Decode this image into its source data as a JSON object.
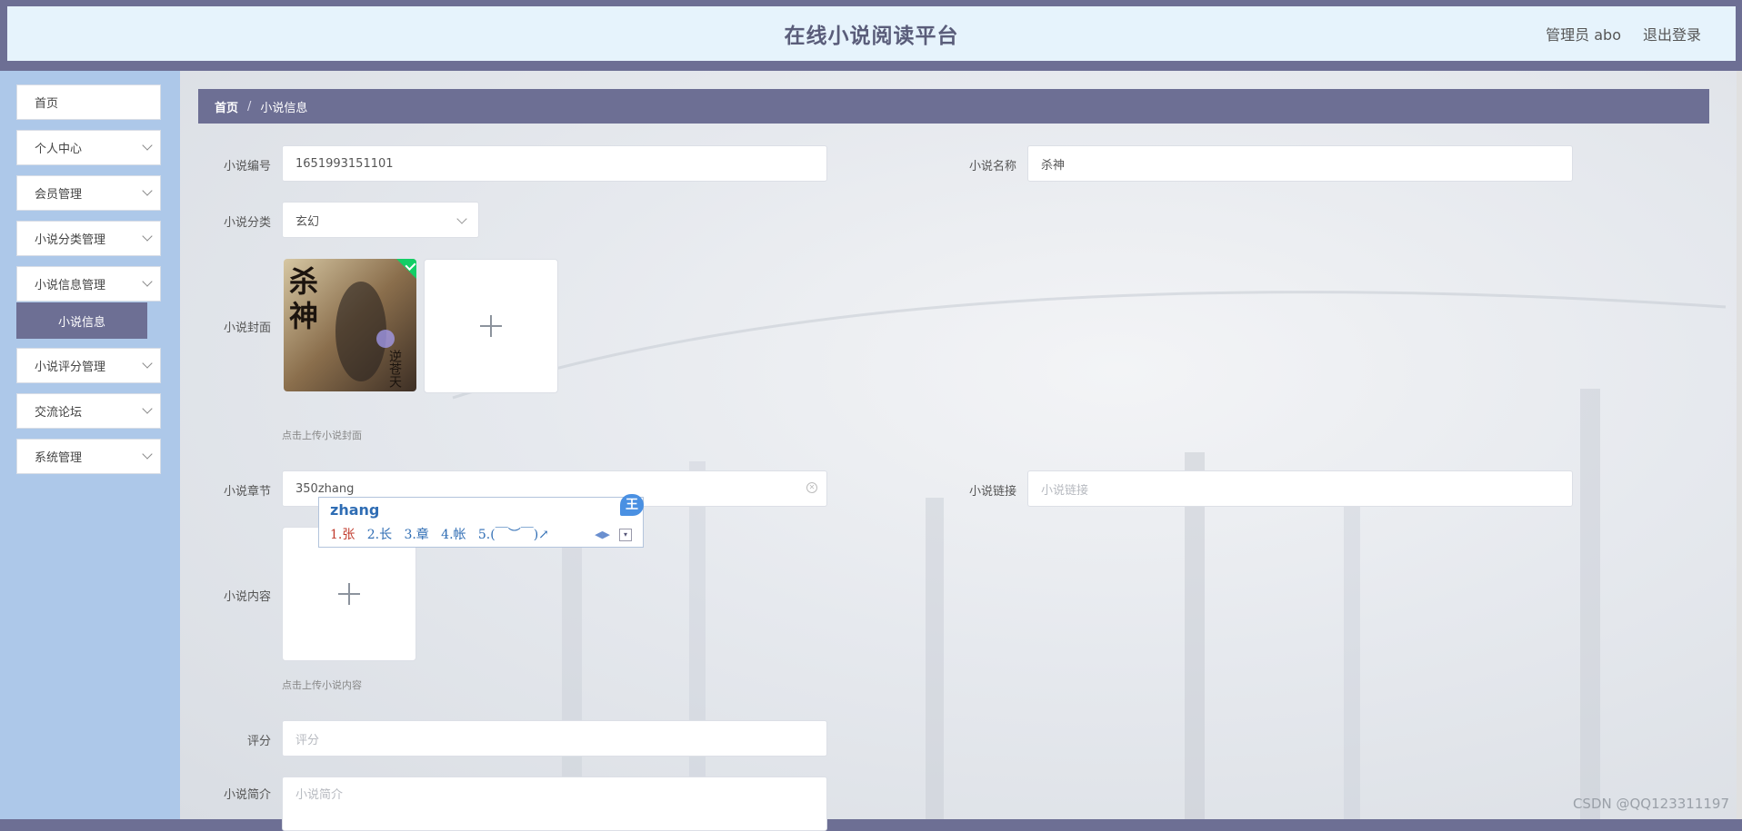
{
  "header": {
    "title": "在线小说阅读平台",
    "user": "管理员 abo",
    "logout": "退出登录"
  },
  "sidebar": {
    "items": [
      {
        "label": "首页"
      },
      {
        "label": "个人中心"
      },
      {
        "label": "会员管理"
      },
      {
        "label": "小说分类管理"
      },
      {
        "label": "小说信息管理"
      },
      {
        "label": "小说评分管理"
      },
      {
        "label": "交流论坛"
      },
      {
        "label": "系统管理"
      }
    ],
    "active_sub": "小说信息"
  },
  "breadcrumb": {
    "home": "首页",
    "sep": "/",
    "current": "小说信息"
  },
  "form": {
    "novel_id_label": "小说编号",
    "novel_id_value": "1651993151101",
    "novel_name_label": "小说名称",
    "novel_name_value": "杀神",
    "category_label": "小说分类",
    "category_value": "玄幻",
    "cover_label": "小说封面",
    "cover_hint": "点击上传小说封面",
    "chapter_label": "小说章节",
    "chapter_value": "350zhang",
    "link_label": "小说链接",
    "link_placeholder": "小说链接",
    "content_label": "小说内容",
    "content_hint": "点击上传小说内容",
    "rating_label": "评分",
    "rating_placeholder": "评分",
    "intro_label": "小说简介",
    "intro_placeholder": "小说简介"
  },
  "ime": {
    "composition": "zhang",
    "candidates": [
      "1.张",
      "2.长",
      "3.章",
      "4.帐",
      "5.(￣︶￣)↗"
    ],
    "badge": "王"
  },
  "watermark": "CSDN @QQ123311197",
  "cover_image": {
    "title_text": "杀神",
    "subtitle_text": "逆苍天"
  }
}
